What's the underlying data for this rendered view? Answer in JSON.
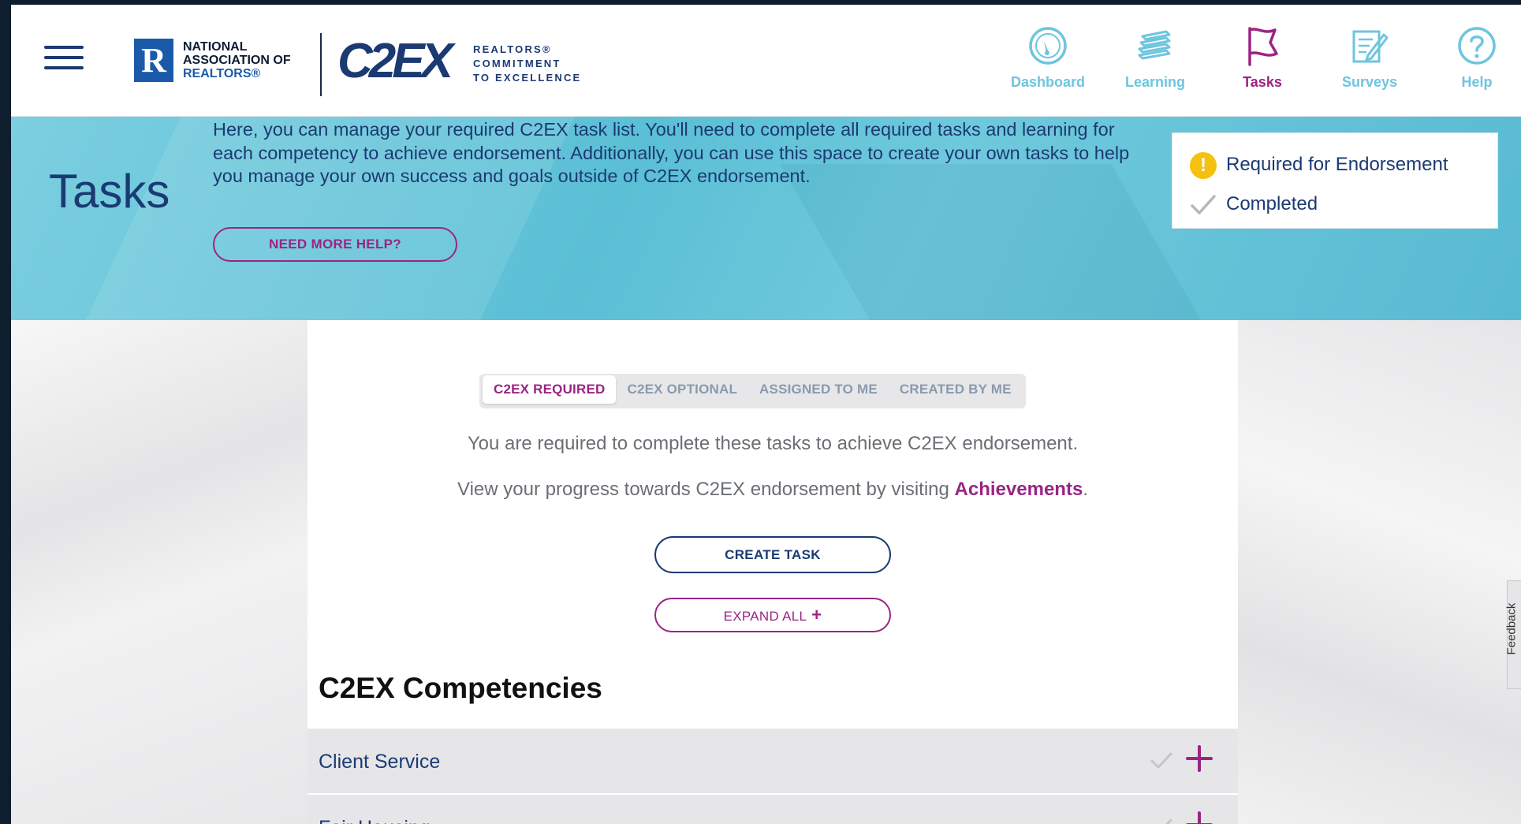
{
  "header": {
    "nar_logo": {
      "mark": "R",
      "line1": "NATIONAL",
      "line2": "ASSOCIATION OF",
      "line3": "REALTORS®"
    },
    "c2ex_logo": {
      "word": "C2EX",
      "tag_line1": "REALTORS®",
      "tag_line2": "COMMITMENT",
      "tag_line3": "TO EXCELLENCE"
    },
    "nav": [
      {
        "label": "Dashboard",
        "icon": "dashboard-icon"
      },
      {
        "label": "Learning",
        "icon": "learning-icon"
      },
      {
        "label": "Tasks",
        "icon": "flag-icon",
        "active": true
      },
      {
        "label": "Surveys",
        "icon": "surveys-icon"
      },
      {
        "label": "Help",
        "icon": "help-icon"
      }
    ]
  },
  "banner": {
    "title": "Tasks",
    "description": "Here, you can manage your required C2EX task list. You'll need to complete all required tasks and learning for each competency to achieve endorsement. Additionally, you can use this space to create your own tasks to help you manage your own success and goals outside of C2EX endorsement.",
    "help_button": "NEED MORE HELP?",
    "legend": {
      "required_icon_glyph": "!",
      "required": "Required for Endorsement",
      "completed": "Completed"
    }
  },
  "main": {
    "tabs": [
      {
        "label": "C2EX REQUIRED",
        "active": true
      },
      {
        "label": "C2EX OPTIONAL"
      },
      {
        "label": "ASSIGNED TO ME"
      },
      {
        "label": "CREATED BY ME"
      }
    ],
    "required_text": "You are required to complete these tasks to achieve C2EX endorsement.",
    "progress_text": "View your progress towards C2EX endorsement by visiting",
    "progress_link": "Achievements",
    "progress_end": ".",
    "create_button": "CREATE TASK",
    "expand_button": "EXPAND ALL",
    "expand_icon": "+",
    "section_title": "C2EX Competencies",
    "competencies": [
      {
        "label": "Client Service"
      },
      {
        "label": "Fair Housing"
      }
    ]
  },
  "feedback": "Feedback",
  "colors": {
    "brand_navy": "#1b3a72",
    "accent_magenta": "#9b2483",
    "nav_teal": "#6ec5df",
    "warning_yellow": "#f4c10e",
    "banner_blue": "#5bbfd5"
  }
}
